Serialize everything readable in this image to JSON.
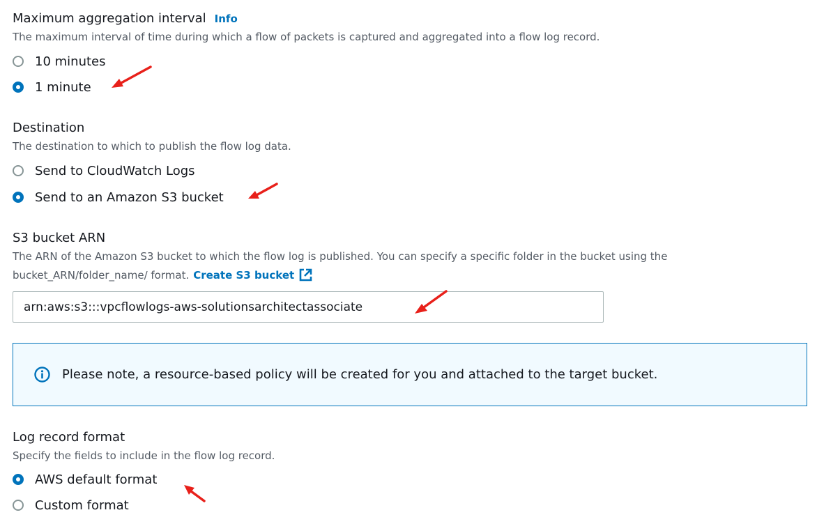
{
  "aggregation": {
    "label": "Maximum aggregation interval",
    "info_link": "Info",
    "description": "The maximum interval of time during which a flow of packets is captured and aggregated into a flow log record.",
    "options": [
      {
        "label": "10 minutes",
        "selected": false
      },
      {
        "label": "1 minute",
        "selected": true
      }
    ]
  },
  "destination": {
    "label": "Destination",
    "description": "The destination to which to publish the flow log data.",
    "options": [
      {
        "label": "Send to CloudWatch Logs",
        "selected": false
      },
      {
        "label": "Send to an Amazon S3 bucket",
        "selected": true
      }
    ]
  },
  "s3_bucket": {
    "label": "S3 bucket ARN",
    "description_line1": "The ARN of the Amazon S3 bucket to which the flow log is published. You can specify a specific folder in the bucket using the",
    "description_line2": "bucket_ARN/folder_name/ format.",
    "create_link": "Create S3 bucket",
    "create_link_icon": "external-link-icon",
    "value": "arn:aws:s3:::vpcflowlogs-aws-solutionsarchitectassociate"
  },
  "alert": {
    "icon": "info-circle-icon",
    "text": "Please note, a resource-based policy will be created for you and attached to the target bucket."
  },
  "log_format": {
    "label": "Log record format",
    "description": "Specify the fields to include in the flow log record.",
    "options": [
      {
        "label": "AWS default format",
        "selected": true
      },
      {
        "label": "Custom format",
        "selected": false
      }
    ]
  },
  "colors": {
    "accent": "#0073bb",
    "annotation_arrow": "#e8201a",
    "alert_background": "#f1faff"
  }
}
